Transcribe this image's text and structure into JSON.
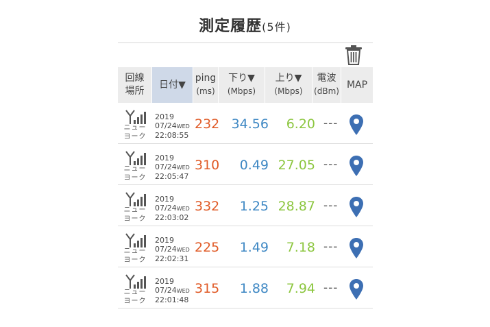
{
  "header": {
    "title": "測定履歴",
    "count": "(5件)"
  },
  "columns": {
    "line": [
      "回線",
      "場所"
    ],
    "date": "日付▼",
    "ping": [
      "ping",
      "(ms)"
    ],
    "down": [
      "下り▼",
      "(Mbps)"
    ],
    "up": [
      "上り▼",
      "(Mbps)"
    ],
    "dbm": [
      "電波",
      "(dBm)"
    ],
    "map": "MAP"
  },
  "colors": {
    "ping": "#e05a26",
    "down": "#3d87c3",
    "up": "#8cc63f",
    "pin": "#3d6fb3"
  },
  "icons": {
    "trash": "trash-icon",
    "antenna": "signal-antenna-icon",
    "map": "map-pin-icon"
  },
  "rows": [
    {
      "city1": "ニュー",
      "city2": "ヨーク",
      "year": "2019",
      "md": "07/24",
      "dow": "WED",
      "time": "22:08:55",
      "ping": "232",
      "down": "34.56",
      "up": "6.20",
      "dbm": "---"
    },
    {
      "city1": "ニュー",
      "city2": "ヨーク",
      "year": "2019",
      "md": "07/24",
      "dow": "WED",
      "time": "22:05:47",
      "ping": "310",
      "down": "0.49",
      "up": "27.05",
      "dbm": "---"
    },
    {
      "city1": "ニュー",
      "city2": "ヨーク",
      "year": "2019",
      "md": "07/24",
      "dow": "WED",
      "time": "22:03:02",
      "ping": "332",
      "down": "1.25",
      "up": "28.87",
      "dbm": "---"
    },
    {
      "city1": "ニュー",
      "city2": "ヨーク",
      "year": "2019",
      "md": "07/24",
      "dow": "WED",
      "time": "22:02:31",
      "ping": "225",
      "down": "1.49",
      "up": "7.18",
      "dbm": "---"
    },
    {
      "city1": "ニュー",
      "city2": "ヨーク",
      "year": "2019",
      "md": "07/24",
      "dow": "WED",
      "time": "22:01:48",
      "ping": "315",
      "down": "1.88",
      "up": "7.94",
      "dbm": "---"
    }
  ]
}
